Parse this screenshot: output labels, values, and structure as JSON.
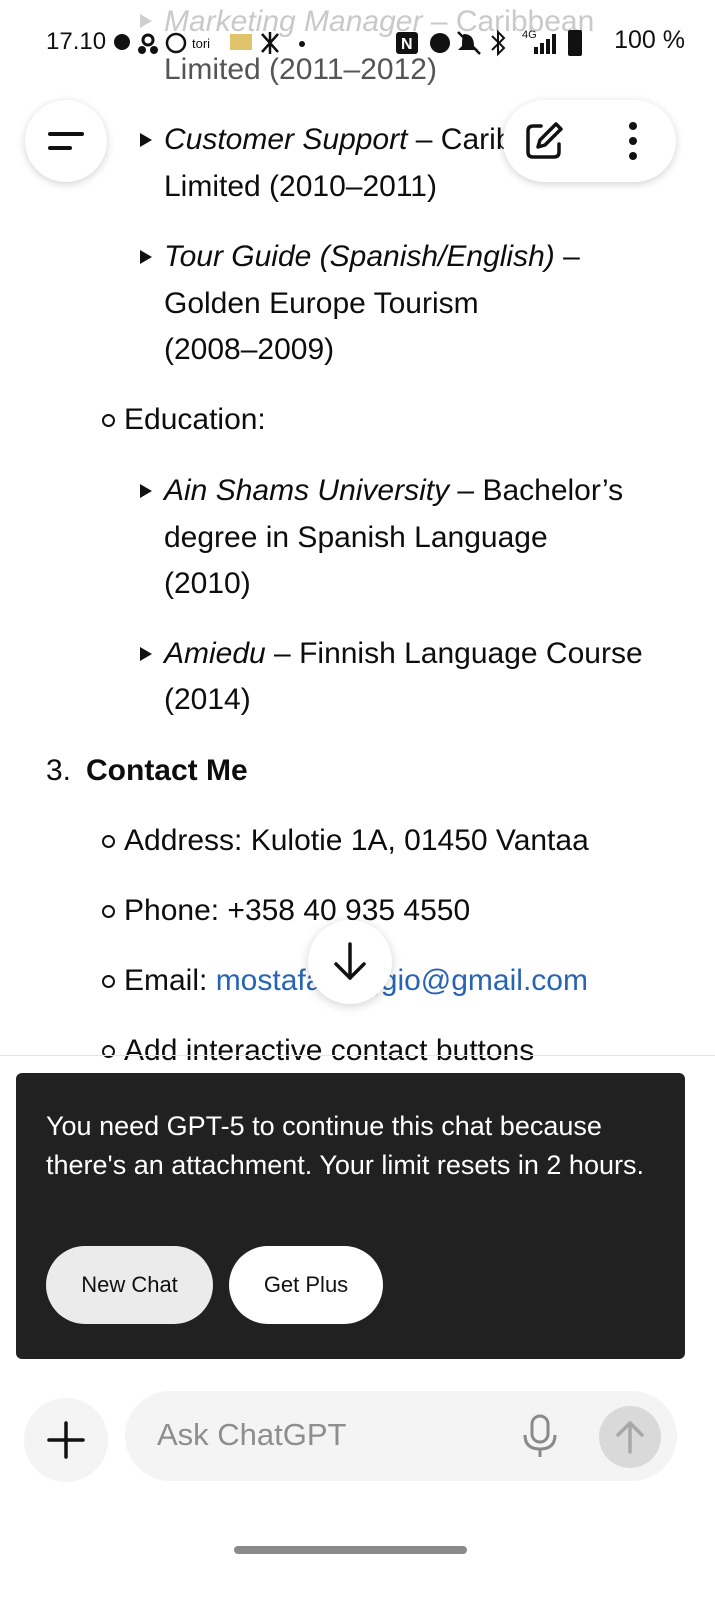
{
  "status_bar": {
    "time": "17.10",
    "network": "4G",
    "battery": "100 %"
  },
  "content": {
    "job_marketing_title": "Marketing Manager",
    "job_marketing_org": " – Caribbean",
    "job_marketing_cont": "Limited (2011–2012)",
    "job_support_title": "Customer Support",
    "job_support_org": " – Caribbean",
    "job_support_cont": "Limited (2010–2011)",
    "job_guide_title": "Tour Guide (Spanish/English)",
    "job_guide_org": " –",
    "job_guide_cont1": "Golden Europe Tourism",
    "job_guide_cont2": "(2008–2009)",
    "education_label": "Education:",
    "edu1_title": "Ain Shams University",
    "edu1_desc": " – Bachelor’s",
    "edu1_cont1": "degree in Spanish Language",
    "edu1_cont2": "(2010)",
    "edu2_title": "Amiedu",
    "edu2_desc": " – Finnish Language Course",
    "edu2_cont": "(2014)",
    "section3_number": "3.",
    "section3_title": "Contact Me",
    "address": "Address: Kulotie 1A, 01450 Vantaa",
    "phone": "Phone: +358 40 935 4550",
    "email_label": "Email: ",
    "email_value": "mostafamaggio@gmail.com",
    "add_buttons": "Add interactive contact buttons"
  },
  "banner": {
    "message": "You need GPT-5 to continue this chat because there's an attachment. Your limit resets in 2 hours.",
    "new_chat": "New Chat",
    "get_plus": "Get Plus"
  },
  "composer": {
    "placeholder": "Ask ChatGPT"
  }
}
